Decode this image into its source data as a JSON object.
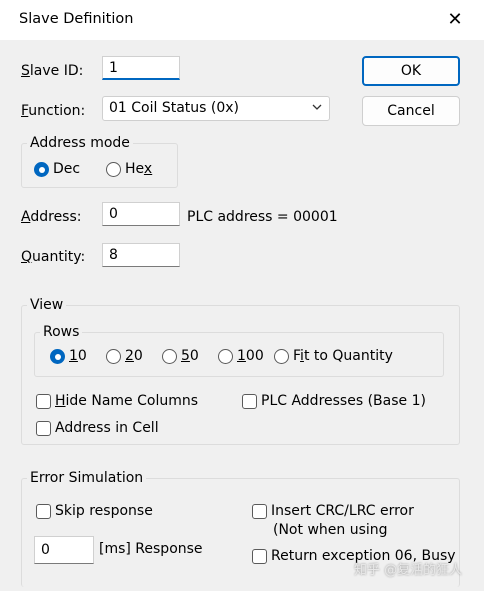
{
  "window": {
    "title": "Slave Definition",
    "close_glyph": "✕"
  },
  "buttons": {
    "ok": "OK",
    "cancel": "Cancel"
  },
  "slave_id": {
    "label_key": "S",
    "label_rest": "lave ID:",
    "value": "1"
  },
  "function": {
    "label_key": "F",
    "label_rest": "unction:",
    "selected": "01 Coil Status (0x)"
  },
  "address_mode": {
    "legend": "Address mode",
    "options": [
      {
        "label": "Dec",
        "key": "",
        "checked": true
      },
      {
        "label_pre": "He",
        "key": "x",
        "checked": false
      }
    ]
  },
  "address": {
    "label_key": "A",
    "label_rest": "ddress:",
    "value": "0",
    "plc_text": "PLC address = 00001"
  },
  "quantity": {
    "label_key": "Q",
    "label_rest": "uantity:",
    "value": "8"
  },
  "view": {
    "legend": "View",
    "rows": {
      "legend": "Rows",
      "options": [
        {
          "key": "1",
          "rest": "0",
          "checked": true
        },
        {
          "key": "2",
          "rest": "0",
          "checked": false
        },
        {
          "key": "5",
          "rest": "0",
          "checked": false
        },
        {
          "key": "1",
          "rest": "00",
          "checked": false
        },
        {
          "pre": "F",
          "key": "i",
          "rest": "t to Quantity",
          "checked": false
        }
      ]
    },
    "hide_name_columns": {
      "key": "H",
      "rest": "ide Name Columns",
      "checked": false
    },
    "plc_addresses": "PLC Addresses (Base 1)",
    "address_in_cell": "Address in Cell"
  },
  "error_sim": {
    "legend": "Error Simulation",
    "skip_response": "Skip response",
    "response_value": "0",
    "response_label": "[ms] Response",
    "insert_crc": "Insert CRC/LRC error",
    "insert_crc_note": "(Not when using",
    "return_exception": "Return exception 06, Busy"
  },
  "watermark": "知乎 @复活的狂人"
}
